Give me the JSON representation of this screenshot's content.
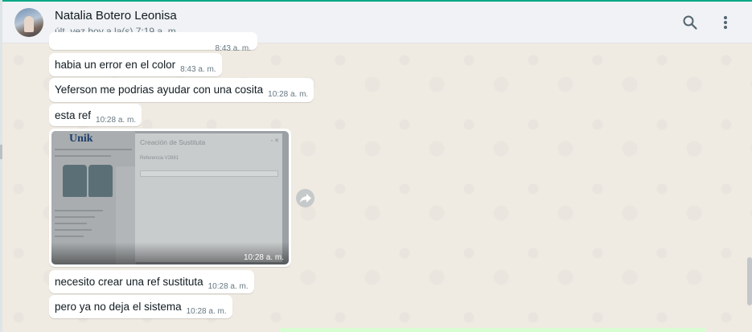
{
  "header": {
    "contact_name": "Natalia Botero Leonisa",
    "last_seen": "últ. vez hoy a la(s) 7:19 a. m.",
    "icons": {
      "search": "search-icon",
      "menu": "kebab-menu-icon"
    }
  },
  "messages": [
    {
      "text": "",
      "time": "8:43 a. m."
    },
    {
      "text": "habia un error en el color",
      "time": "8:43 a. m."
    },
    {
      "text": "Yeferson me podrias ayudar con una cosita",
      "time": "10:28 a. m."
    },
    {
      "text": "esta ref",
      "time": "10:28 a. m."
    },
    {
      "type": "image",
      "time": "10:28 a. m.",
      "image": {
        "logo": "Unik",
        "modal_title": "Creación de Sustituta",
        "modal_ref": "Referencia V2881"
      }
    },
    {
      "text": "necesito crear una ref sustituta",
      "time": "10:28 a. m."
    },
    {
      "text": "pero ya no deja el sistema",
      "time": "10:28 a. m."
    }
  ],
  "colors": {
    "accent": "#00a884",
    "chat_background": "#efeae2",
    "header_background": "#f0f2f5",
    "outgoing_bubble": "#d9fdd3"
  }
}
